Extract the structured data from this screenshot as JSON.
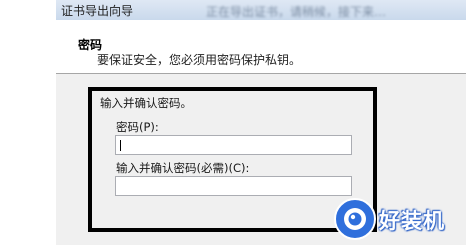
{
  "window": {
    "title": "证书导出向导",
    "title_background_text": "正在导出证书，请稍候，接下来…"
  },
  "header": {
    "title": "密码",
    "description": "要保证安全，您必须用密码保护私钥。"
  },
  "form": {
    "group_label": "输入并确认密码。",
    "password_label": "密码(P):",
    "password_value": "",
    "confirm_label": "输入并确认密码(必需)(C):",
    "confirm_value": ""
  },
  "watermark": {
    "text": "好装机"
  },
  "colors": {
    "titlebar": "#c9d9ec",
    "dialog_background": "#f0f0f0",
    "highlight_border": "#000000",
    "watermark_blue": "#2f6fdc"
  }
}
